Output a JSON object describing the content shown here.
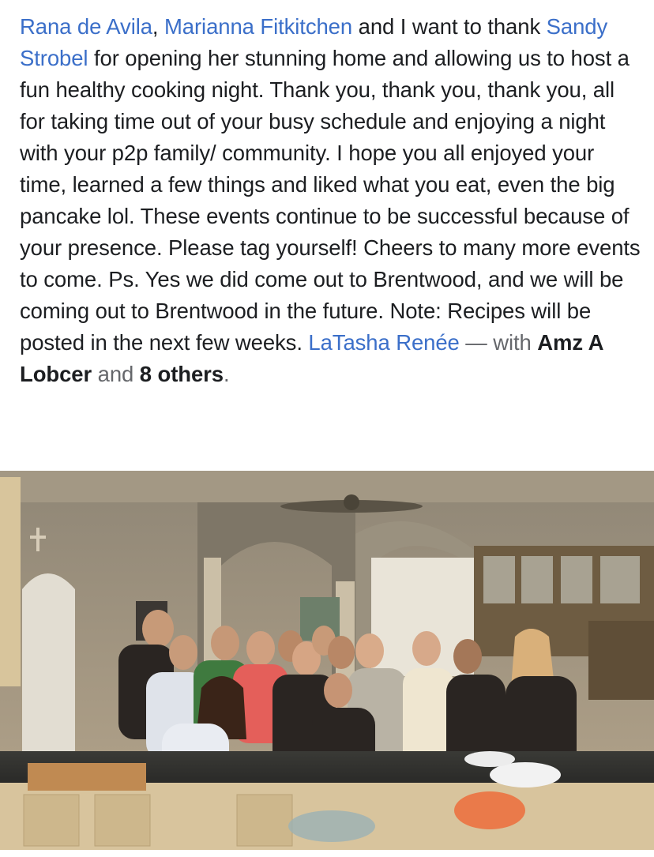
{
  "post": {
    "mention_1": "Rana de Avila",
    "sep_1": ", ",
    "mention_2": "Marianna Fitkitchen",
    "text_1": " and I want to thank ",
    "mention_3": "Sandy Strobel",
    "text_2": " for opening her stunning home and allowing us to host a fun healthy cooking night. Thank you, thank you, thank you, all for taking time out of your busy schedule and enjoying a night with your p2p family/ community. I hope you all enjoyed your time, learned a few things and liked what you eat, even the big pancake lol. These events continue to be successful because of your presence. Please tag yourself!  Cheers to many more events to come. Ps. Yes we did come out to Brentwood, and we will be coming out to Brentwood  in the future. Note: Recipes will be posted in the next few weeks. ",
    "author_tag": "LaTasha Renée",
    "with_text": " — with ",
    "tagged_person": "Amz A Lobcer",
    "and_text": " and ",
    "others_text": "8 others",
    "period": "."
  },
  "photo": {
    "subject": "group-photo-kitchen"
  },
  "colors": {
    "link": "#3b6fc9",
    "text": "#1c1e21",
    "muted": "#65676b"
  }
}
